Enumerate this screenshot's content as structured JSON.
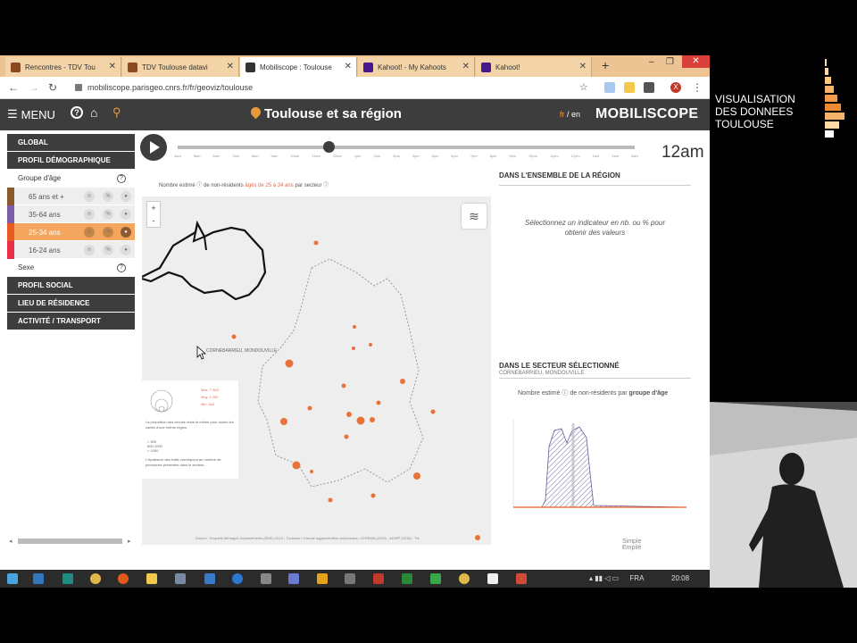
{
  "browser": {
    "tabs": [
      {
        "title": "Rencontres - TDV Tou",
        "favicon_color": "#8a4a1e"
      },
      {
        "title": "TDV Toulouse datavi",
        "favicon_color": "#8a4a1e"
      },
      {
        "title": "Mobiliscope : Toulouse",
        "favicon_color": "#333333"
      },
      {
        "title": "Kahoot! - My Kahoots",
        "favicon_color": "#46178f"
      },
      {
        "title": "Kahoot!",
        "favicon_color": "#46178f"
      }
    ],
    "active_tab_index": 2,
    "url": "mobiliscope.parisgeo.cnrs.fr/fr/geoviz/toulouse",
    "profile_initial": "X"
  },
  "header": {
    "menu_label": "MENU",
    "help_glyph": "?",
    "city_title": "Toulouse et sa région",
    "lang_fr": "fr",
    "lang_sep": "/",
    "lang_en": "en",
    "brand": "MOBILISCOPE"
  },
  "sidebar": {
    "global": "GLOBAL",
    "profil_demo": "PROFIL DÉMOGRAPHIQUE",
    "age_title": "Groupe d'âge",
    "age_groups": [
      {
        "label": "65 ans et +",
        "color": "#8a5a2b"
      },
      {
        "label": "35-64 ans",
        "color": "#7b5ea7"
      },
      {
        "label": "25-34 ans",
        "color": "#e85a22"
      },
      {
        "label": "16-24 ans",
        "color": "#e8304a"
      }
    ],
    "selected_age_index": 2,
    "sexe": "Sexe",
    "profil_social": "PROFIL SOCIAL",
    "lieu_residence": "LIEU DE RÉSIDENCE",
    "activite": "ACTIVITÉ / TRANSPORT"
  },
  "timeline": {
    "current": "12am",
    "progress": 0.33,
    "ticks": [
      "4am",
      "5am",
      "6am",
      "7am",
      "8am",
      "9am",
      "10am",
      "11am",
      "12am",
      "1pm",
      "2pm",
      "3pm",
      "4pm",
      "5pm",
      "6pm",
      "7pm",
      "8pm",
      "9pm",
      "10pm",
      "11pm",
      "12pm",
      "1am",
      "2am",
      "3am"
    ]
  },
  "map": {
    "title_pre": "Nombre estimé ⓘ de non-résidents",
    "title_hl": "âgés de 25 à 34 ans",
    "title_post": "par secteur ⓘ",
    "zoom_in": "+",
    "zoom_out": "-",
    "selected_sector_label": "CORNEBARRIEU, MONDOUVILLE",
    "legend": {
      "max": "Max. 7 383",
      "mid": "Moy. 4 200",
      "min": "Min. 842",
      "note": "La proportion des cercles reste la même pour toutes les cartes d'une même région.",
      "borders": [
        "< 500",
        "500-1000",
        "> 1000"
      ],
      "note2": "L'épaisseur des traits correspond au nombre de personnes présentes dans le secteur."
    },
    "attribution": "Source : Enquête Ménages Déplacements (EMD) 2013 - Toulouse / Grande agglomération toulousaine, CEREMA (2013) - ADISP (2018) · Tls"
  },
  "right_panel": {
    "ensemble_title": "DANS L'ENSEMBLE DE LA RÉGION",
    "hint": "Sélectionnez un indicateur en nb. ou % pour obtenir des valeurs",
    "secteur_title": "DANS LE SECTEUR SÉLECTIONNÉ",
    "secteur_name": "CORNEBARRIEU, MONDOUVILLE",
    "chart_title_pre": "Nombre estimé ⓘ de non-résidents par",
    "chart_title_bold": "groupe d'âge",
    "mode_simple": "Simple",
    "mode_empile": "Empilé"
  },
  "taskbar": {
    "lang": "FRA",
    "time": "20:08"
  },
  "slide": {
    "line1": "VISUALISATION",
    "line2": "DES DONNEES",
    "line3": "TOULOUSE"
  }
}
